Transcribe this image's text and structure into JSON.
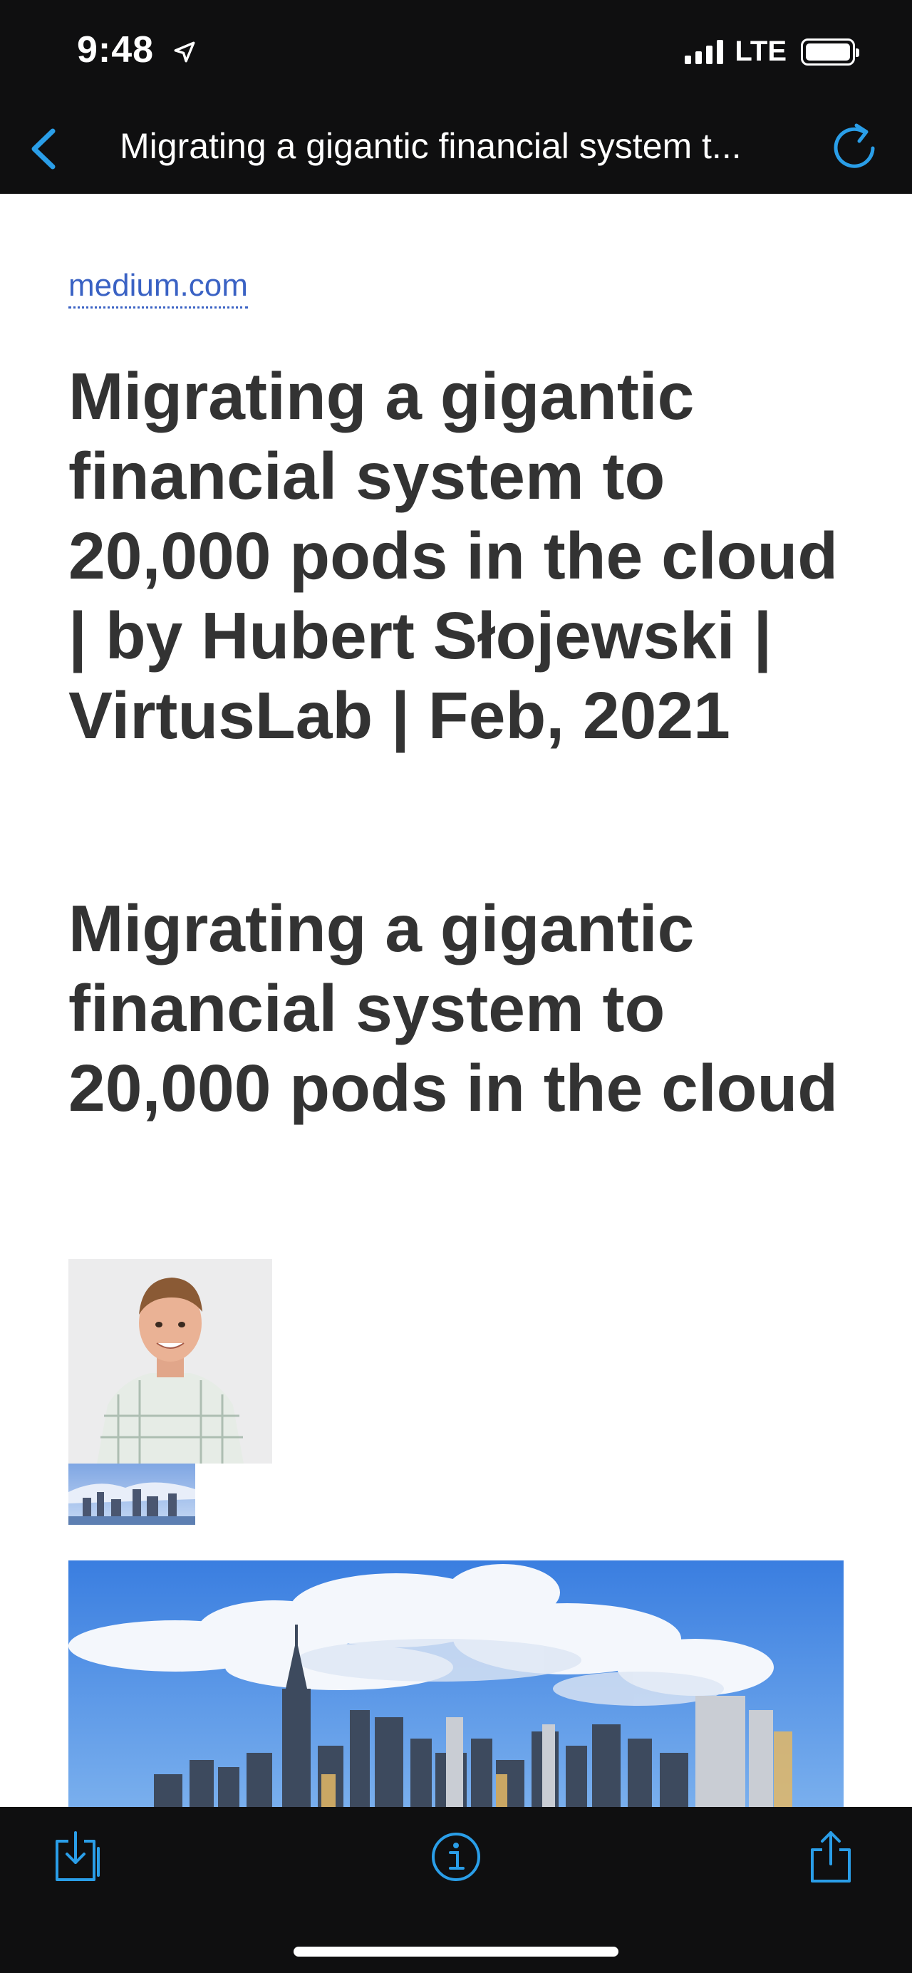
{
  "status_bar": {
    "time": "9:48",
    "network": "LTE",
    "signal_bars": 4,
    "location_icon": "location-arrow-icon",
    "battery_icon": "battery-icon"
  },
  "nav": {
    "back_icon": "chevron-left-icon",
    "title": "Migrating a gigantic financial system t...",
    "reload_icon": "reload-icon"
  },
  "article": {
    "source": "medium.com",
    "page_title": "Migrating a gigantic financial system to 20,000 pods in the cloud | by Hubert Słojewski | VirtusLab | Feb, 2021",
    "heading": "Migrating a gigantic financial system to 20,000 pods in the cloud",
    "images": [
      "author-avatar",
      "thumbnail-image",
      "city-skyline-hero-image"
    ]
  },
  "toolbar": {
    "download_icon": "download-icon",
    "info_icon": "info-icon",
    "share_icon": "share-icon"
  },
  "colors": {
    "accent": "#2a9ee8",
    "link": "#3a62c4",
    "heading_text": "#333333",
    "chrome_bg": "#0f0f10"
  }
}
